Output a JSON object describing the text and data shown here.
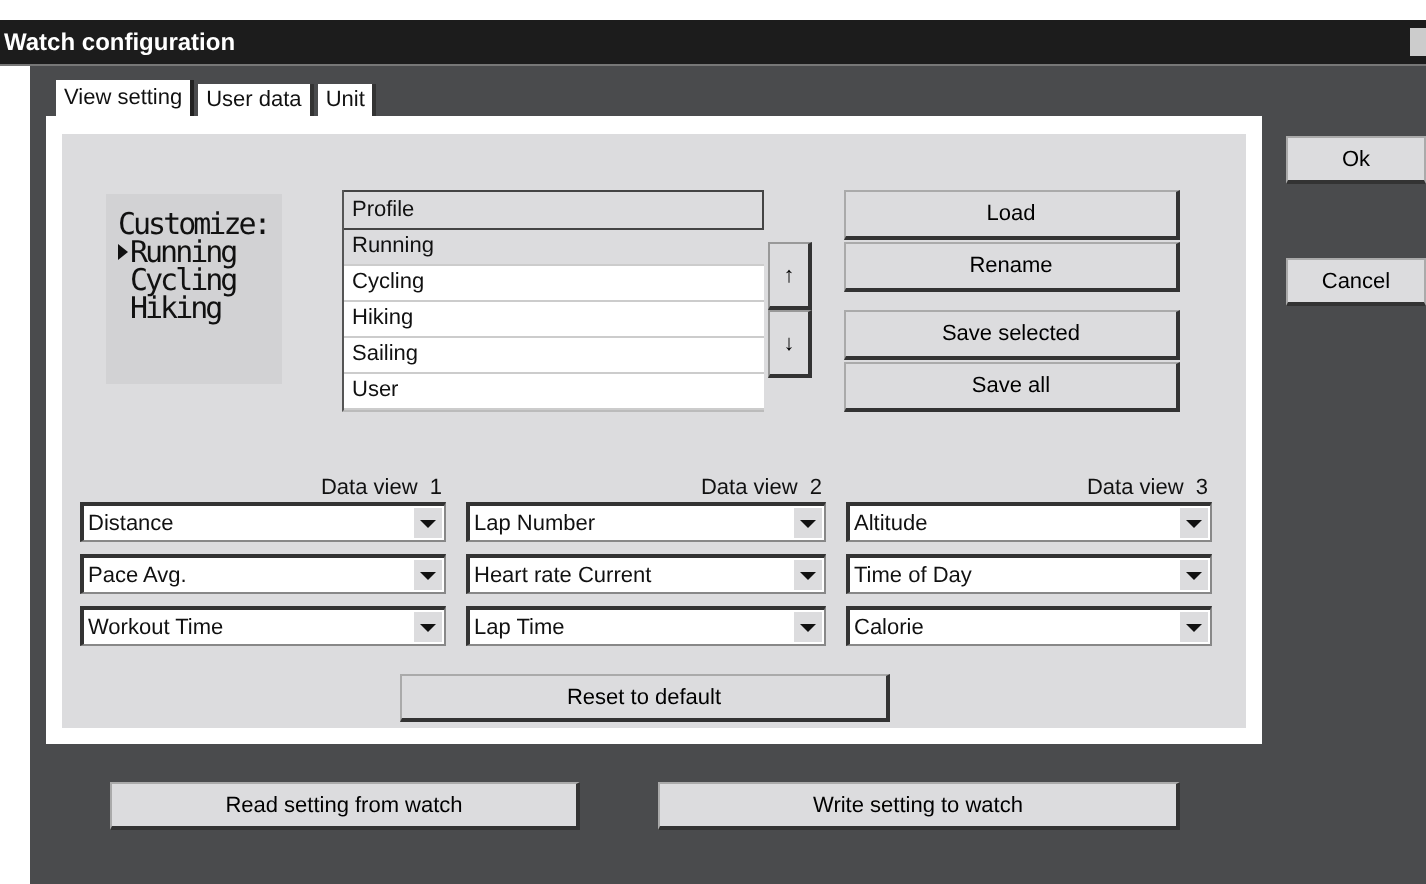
{
  "window": {
    "title": "Watch configuration"
  },
  "tabs": [
    {
      "label": "View setting",
      "selected": true
    },
    {
      "label": "User data",
      "selected": false
    },
    {
      "label": "Unit",
      "selected": false
    }
  ],
  "lcd": {
    "heading": "Customize:",
    "items": [
      {
        "label": "Running",
        "selected": true
      },
      {
        "label": "Cycling",
        "selected": false
      },
      {
        "label": "Hiking",
        "selected": false
      }
    ]
  },
  "profile_list": {
    "header": "Profile",
    "rows": [
      {
        "label": "Running",
        "selected": true
      },
      {
        "label": "Cycling",
        "selected": false
      },
      {
        "label": "Hiking",
        "selected": false
      },
      {
        "label": "Sailing",
        "selected": false
      },
      {
        "label": "User",
        "selected": false
      }
    ]
  },
  "move_buttons": [
    "↑",
    "↓"
  ],
  "profile_buttons": [
    "Load",
    "Rename",
    "Save selected",
    "Save all"
  ],
  "data_views": [
    {
      "label": "Data view  1",
      "fields": [
        "Distance",
        "Pace Avg.",
        "Workout Time"
      ]
    },
    {
      "label": "Data view  2",
      "fields": [
        "Lap Number",
        "Heart rate Current",
        "Lap Time"
      ]
    },
    {
      "label": "Data view  3",
      "fields": [
        "Altitude",
        "Time of Day",
        "Calorie"
      ]
    }
  ],
  "reset_button": "Reset to default",
  "dialog_buttons": [
    "Ok",
    "Cancel"
  ],
  "bottom_buttons": [
    "Read setting from watch",
    "Write setting to watch"
  ]
}
